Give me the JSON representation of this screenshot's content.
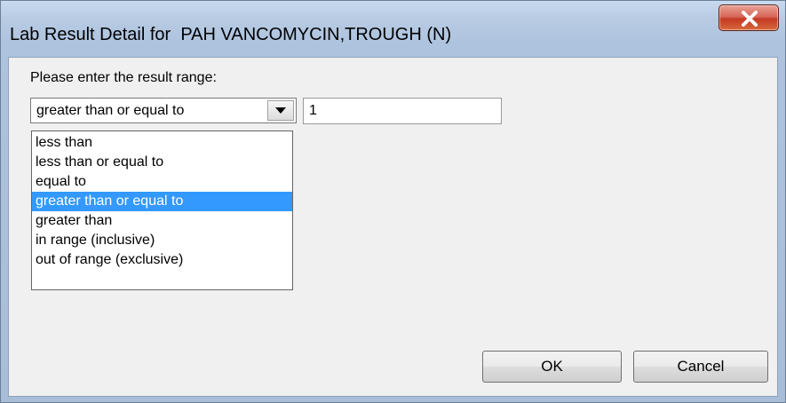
{
  "window": {
    "title": "Lab Result Detail for  PAH VANCOMYCIN,TROUGH (N)",
    "close_icon": "close-x-icon"
  },
  "form": {
    "prompt": "Please enter the result range:",
    "operator_selected": "greater than or equal to",
    "operator_options": [
      "less than",
      "less than or equal to",
      "equal to",
      "greater than or equal to",
      "greater than",
      "in range (inclusive)",
      "out of range (exclusive)"
    ],
    "selected_index": 3,
    "value": "1"
  },
  "buttons": {
    "ok_label": "OK",
    "cancel_label": "Cancel"
  },
  "colors": {
    "selection_highlight": "#3399ff",
    "close_button": "#c43a24",
    "dialog_background": "#f0f0f0"
  }
}
